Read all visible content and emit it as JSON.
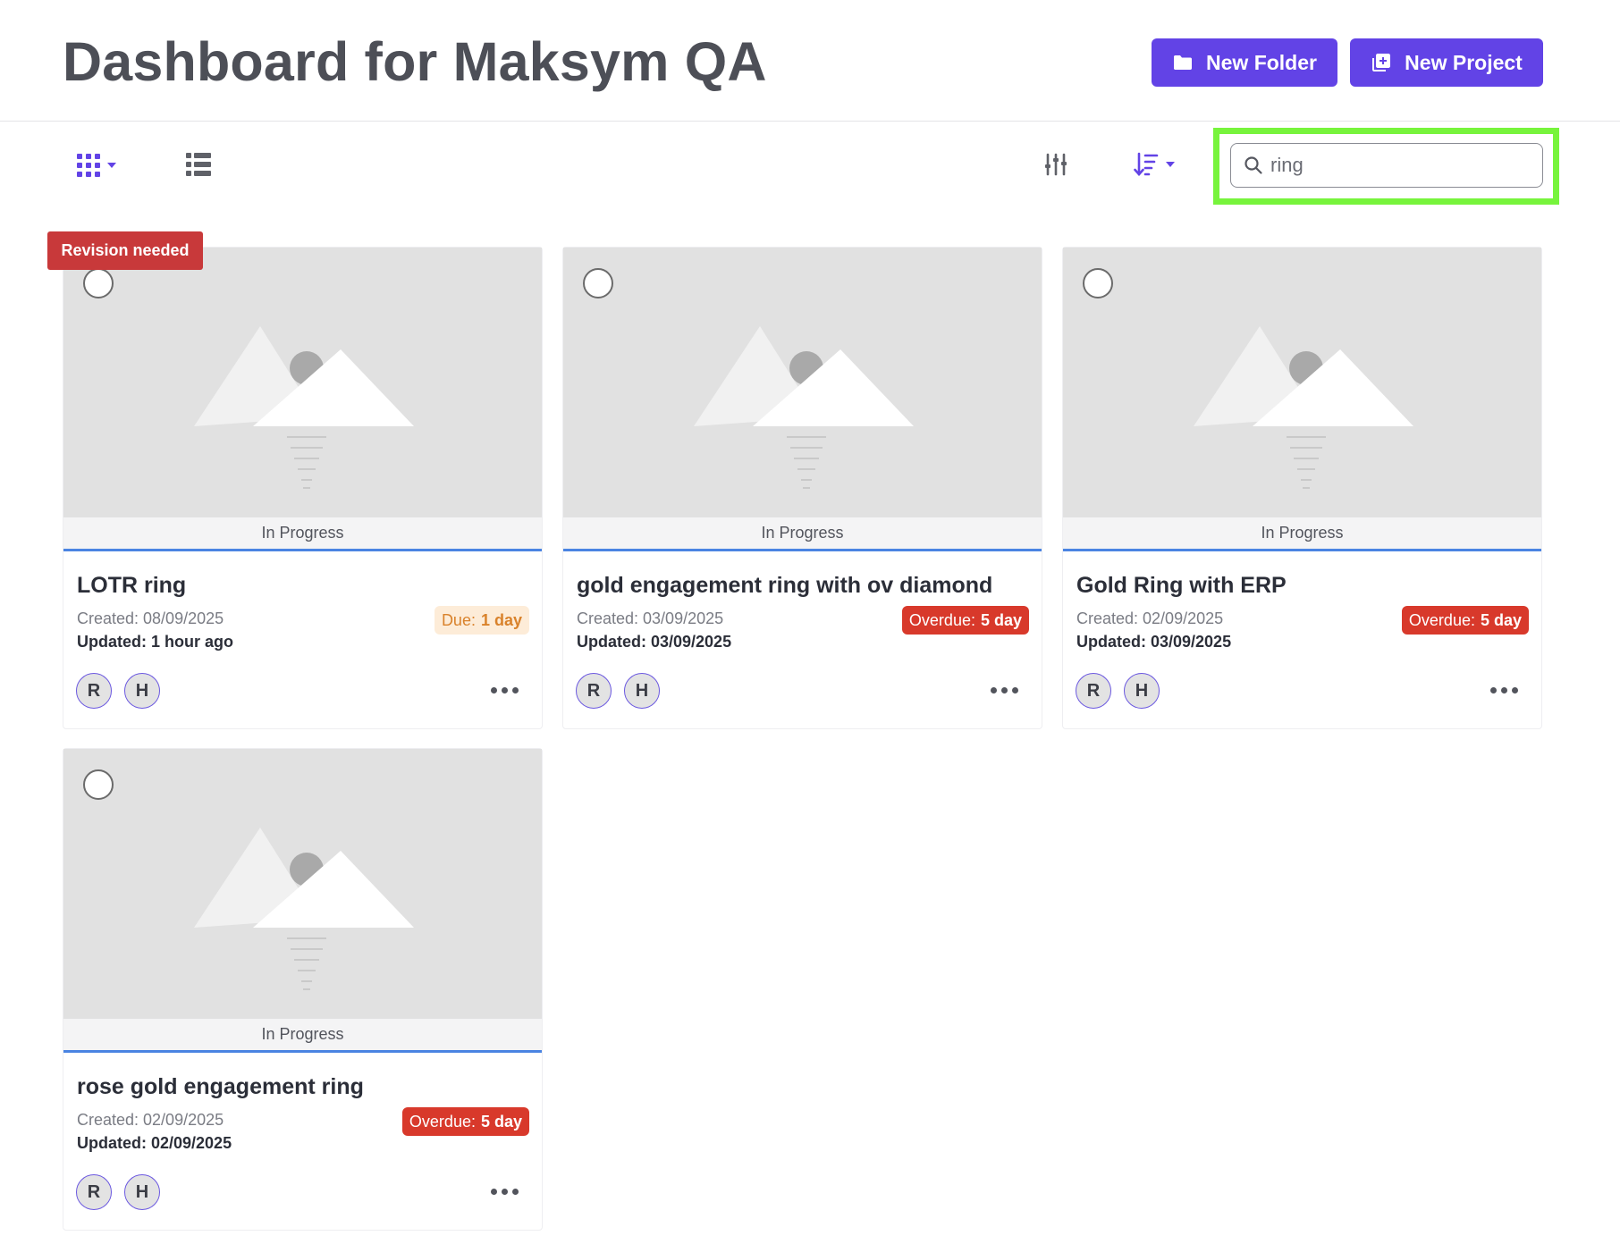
{
  "header": {
    "title": "Dashboard for Maksym QA",
    "new_folder_label": "New Folder",
    "new_project_label": "New Project",
    "accent_color": "#6243e6"
  },
  "toolbar": {
    "grid_view_icon": "grid-icon",
    "list_view_icon": "list-icon",
    "filter_icon": "sliders-icon",
    "sort_icon": "sort-icon",
    "search": {
      "value": "ring",
      "icon": "search-icon"
    }
  },
  "projects": [
    {
      "flag": "Revision needed",
      "status": "In Progress",
      "title": "LOTR ring",
      "created": "Created: 08/09/2025",
      "updated": "Updated: 1 hour ago",
      "due_label": "Due:",
      "due_value": "1 day",
      "due_type": "due",
      "avatars": [
        "R",
        "H"
      ]
    },
    {
      "status": "In Progress",
      "title": "gold engagement ring with ov diamond",
      "created": "Created: 03/09/2025",
      "updated": "Updated: 03/09/2025",
      "due_label": "Overdue:",
      "due_value": "5 day",
      "due_type": "overdue",
      "avatars": [
        "R",
        "H"
      ]
    },
    {
      "status": "In Progress",
      "title": "Gold Ring with ERP",
      "created": "Created: 02/09/2025",
      "updated": "Updated: 03/09/2025",
      "due_label": "Overdue:",
      "due_value": "5 day",
      "due_type": "overdue",
      "avatars": [
        "R",
        "H"
      ]
    },
    {
      "status": "In Progress",
      "title": "rose gold engagement ring",
      "created": "Created: 02/09/2025",
      "updated": "Updated: 02/09/2025",
      "due_label": "Overdue:",
      "due_value": "5 day",
      "due_type": "overdue",
      "avatars": [
        "R",
        "H"
      ]
    }
  ],
  "colors": {
    "status_underline": "#4a84e2",
    "overdue": "#d8392b",
    "due_bg": "#fdecd8",
    "due_text": "#d9822b",
    "revision": "#c8393a",
    "highlight": "#77f43c"
  }
}
